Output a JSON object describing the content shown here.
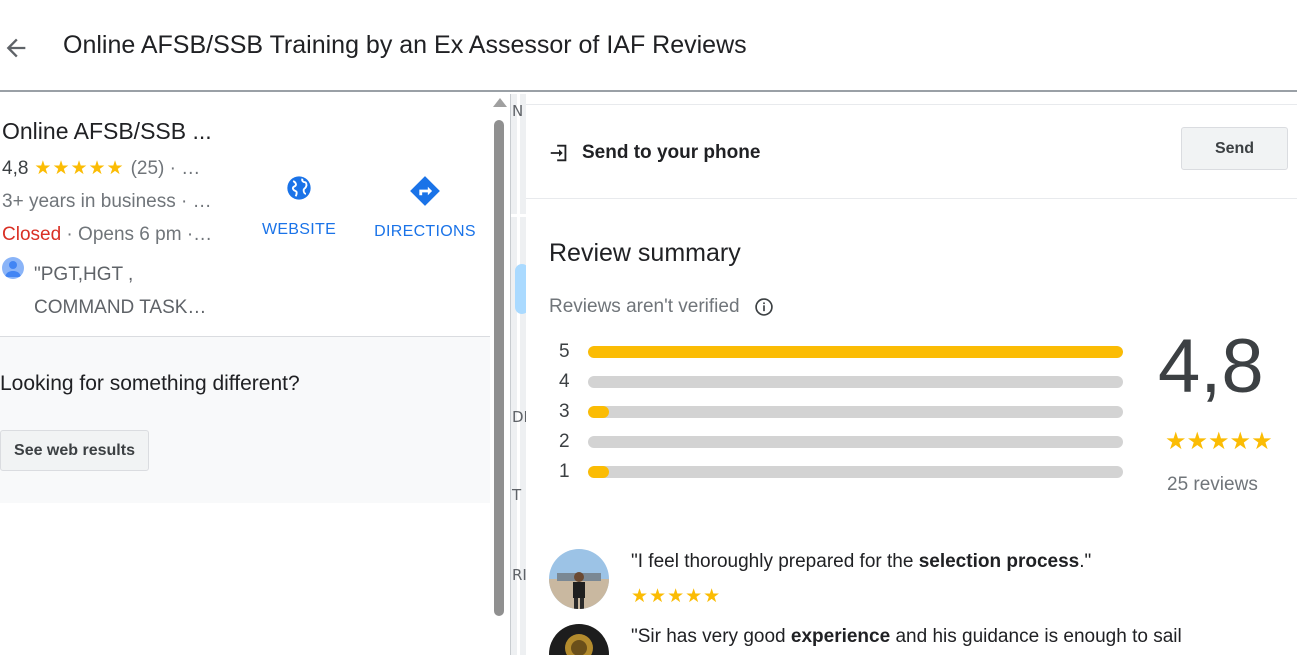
{
  "header": {
    "title": "Online AFSB/SSB Training by an Ex Assessor of IAF Reviews",
    "back_icon": "arrow-back-icon"
  },
  "business": {
    "name": "Online AFSB/SSB ...",
    "rating": "4,8",
    "stars": "★★★★★",
    "review_count": "(25) · …",
    "years": "3+ years in business · …",
    "status_closed": "Closed",
    "status_opens": " · Opens 6 pm ·…",
    "snippet": "\"PGT,HGT , COMMAND TASK…"
  },
  "actions": {
    "website_label": "WEBSITE",
    "directions_label": "DIRECTIONS",
    "accent": "#1a73e8"
  },
  "different": {
    "title": "Looking for something different?",
    "button_label": "See web results"
  },
  "send": {
    "label": "Send to your phone",
    "button_label": "Send"
  },
  "review_summary": {
    "title": "Review summary",
    "subtitle": "Reviews aren't verified",
    "rating": "4,8",
    "stars": "★★★★★",
    "count_label": "25 reviews",
    "star_color": "#fbbc04",
    "distribution": [
      {
        "label": "5",
        "fraction": 1.0
      },
      {
        "label": "4",
        "fraction": 0.0
      },
      {
        "label": "3",
        "fraction": 0.04
      },
      {
        "label": "2",
        "fraction": 0.0
      },
      {
        "label": "1",
        "fraction": 0.04
      }
    ]
  },
  "reviews": [
    {
      "quote_pre": "\"I feel thoroughly prepared for the ",
      "quote_bold": "selection process",
      "quote_post": ".\"",
      "stars": "★★★★★"
    },
    {
      "quote_pre": "\"Sir has very good ",
      "quote_bold": "experience",
      "quote_post": " and his guidance is enough to sail",
      "stars": ""
    }
  ],
  "map_labels": [
    "N",
    "DF",
    "T",
    "RI"
  ]
}
